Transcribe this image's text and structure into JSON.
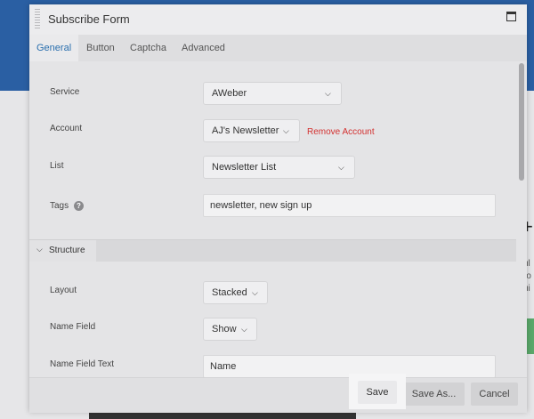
{
  "window": {
    "title": "Subscribe Form"
  },
  "tabs": [
    {
      "label": "General",
      "active": true
    },
    {
      "label": "Button",
      "active": false
    },
    {
      "label": "Captcha",
      "active": false
    },
    {
      "label": "Advanced",
      "active": false
    }
  ],
  "general": {
    "service": {
      "label": "Service",
      "value": "AWeber"
    },
    "account": {
      "label": "Account",
      "value": "AJ's Newsletter",
      "remove_label": "Remove Account"
    },
    "list": {
      "label": "List",
      "value": "Newsletter List"
    },
    "tags": {
      "label": "Tags",
      "value": "newsletter, new sign up",
      "help_glyph": "?"
    }
  },
  "structure": {
    "section_label": "Structure",
    "layout": {
      "label": "Layout",
      "value": "Stacked"
    },
    "name_field": {
      "label": "Name Field",
      "value": "Show"
    },
    "name_field_text": {
      "label": "Name Field Text",
      "value": "Name"
    }
  },
  "footer": {
    "save_label": "Save",
    "save_as_label": "Save As...",
    "cancel_label": "Cancel"
  },
  "icons": {
    "chevron": "chevron-down-icon",
    "maximize": "maximize-icon",
    "help": "help-icon"
  },
  "colors": {
    "accent": "#2a6fae",
    "danger": "#d3302f",
    "header_bg": "#2a5fa3"
  }
}
